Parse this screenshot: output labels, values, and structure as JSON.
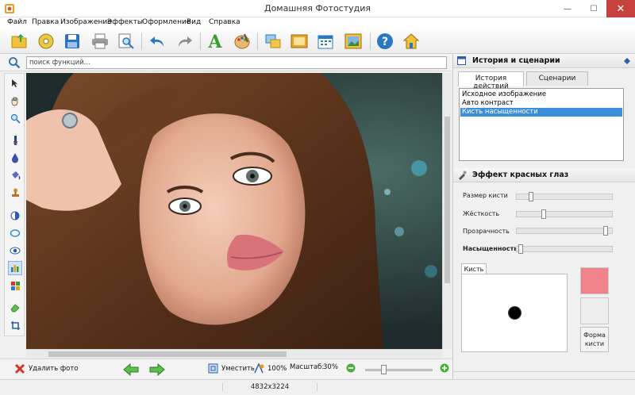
{
  "window": {
    "title": "Домашняя Фотостудия",
    "min_glyph": "—",
    "max_glyph": "☐",
    "close_glyph": "✕"
  },
  "menu": [
    "Файл",
    "Правка",
    "Изображение",
    "Эффекты",
    "Оформление",
    "Вид",
    "Справка"
  ],
  "toolbar": {
    "icons": [
      "open-folder-icon",
      "cd-disc-icon",
      "save-disk-icon",
      "print-icon",
      "zoom-preview-icon",
      "undo-icon",
      "redo-icon",
      "text-icon",
      "palette-icon",
      "frames-icon",
      "photo-frame-icon",
      "calendar-icon",
      "collage-icon",
      "help-icon",
      "home-icon"
    ]
  },
  "search": {
    "placeholder": "поиск функций..."
  },
  "left_tools": [
    "pointer-tool-icon",
    "hand-tool-icon",
    "zoom-tool-icon",
    "brush-tool-icon",
    "drop-tool-icon",
    "bucket-tool-icon",
    "stamp-tool-icon",
    "half-circle-tool-icon",
    "ellipse-tool-icon",
    "eye-tool-icon",
    "levels-tool-icon",
    "squares-tool-icon",
    "eraser-tool-icon",
    "crop-tool-icon"
  ],
  "bottom": {
    "delete_label": "Удалить фото",
    "fit_label": "Уместить",
    "actual_label": "100%",
    "zoom_label": "Масштаб:",
    "zoom_value": "30%",
    "zoom_level": 0.25
  },
  "status": {
    "dimensions": "4832x3224"
  },
  "history_panel": {
    "title": "История и сценарии",
    "tabs": [
      "История действий",
      "Сценарии"
    ],
    "items": [
      "Исходное изображение",
      "Авто контраст",
      "Кисть насыщенности"
    ],
    "selected_index": 2
  },
  "effect_panel": {
    "title": "Эффект красных глаз",
    "params": [
      {
        "label": "Размер кисти",
        "value": 0.13,
        "bold": false
      },
      {
        "label": "Жёсткость",
        "value": 0.28,
        "bold": false
      },
      {
        "label": "Прозрачность",
        "value": 0.97,
        "bold": false
      },
      {
        "label": "Насыщенность",
        "value": 0.02,
        "bold": true
      }
    ],
    "brush_tab": "Кисть",
    "form_button_line1": "Форма",
    "form_button_line2": "кисти",
    "swatch_color": "#f08289",
    "swatch_color2": "#eeeeee"
  },
  "colors": {
    "accent": "#3c8fdb",
    "close_red": "#c7423d"
  }
}
